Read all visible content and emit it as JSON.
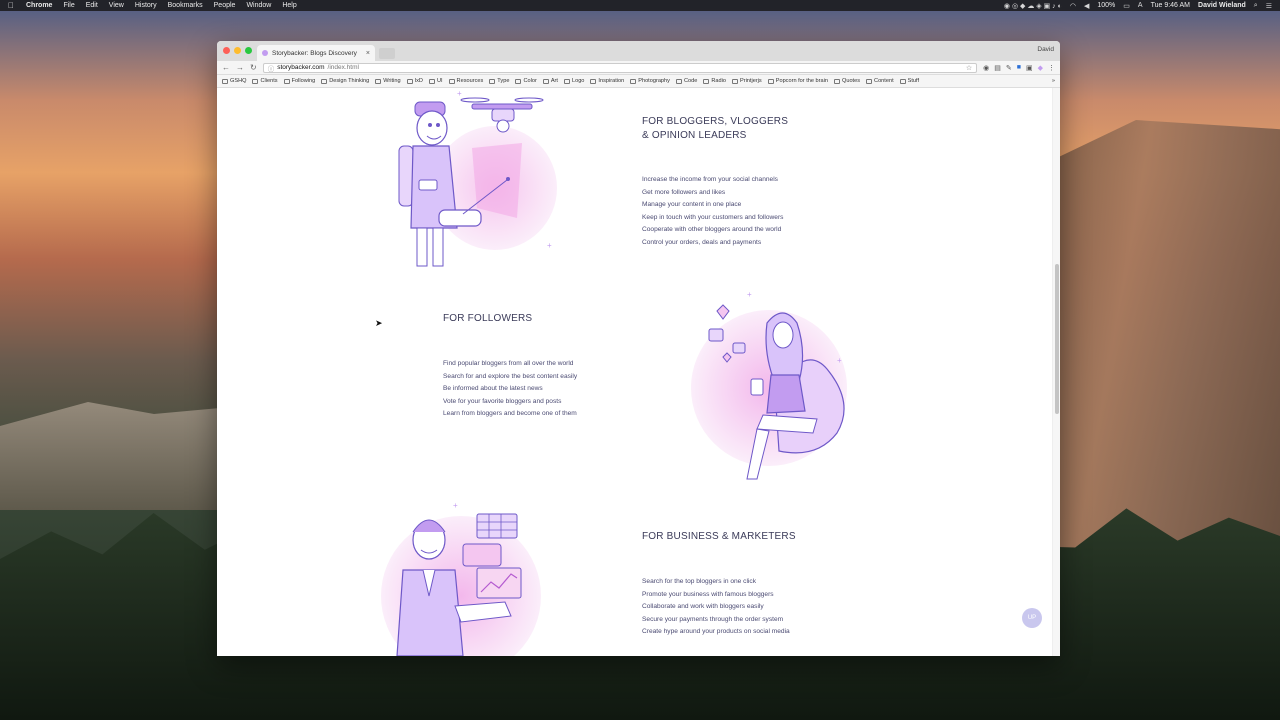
{
  "menubar": {
    "items": [
      "Chrome",
      "File",
      "Edit",
      "View",
      "History",
      "Bookmarks",
      "People",
      "Window",
      "Help"
    ],
    "battery": "100%",
    "clock": "Tue 9:46 AM",
    "user": "David Wieland"
  },
  "browser": {
    "tab_title": "Storybacker: Blogs Discovery",
    "profile": "David",
    "url_host": "storybacker.com",
    "url_path": "/index.html",
    "bookmarks": [
      "GSHQ",
      "Clients",
      "Following",
      "Design Thinking",
      "Writing",
      "IxD",
      "UI",
      "Resources",
      "Type",
      "Color",
      "Art",
      "Logo",
      "Inspiration",
      "Photography",
      "Code",
      "Radio",
      "Printjerjs",
      "Popcorn for the brain",
      "Quotes",
      "Content",
      "Stuff"
    ]
  },
  "sections": [
    {
      "title": "FOR BLOGGERS, VLOGGERS\n& OPINION LEADERS",
      "items": [
        "Increase the income from your social channels",
        "Get more followers and likes",
        "Manage your content in one place",
        "Keep in touch with your customers and followers",
        "Cooperate with other bloggers around the world",
        "Control your orders, deals and payments"
      ]
    },
    {
      "title": "FOR FOLLOWERS",
      "items": [
        "Find popular bloggers from all over the world",
        "Search for and explore the best content easily",
        "Be informed about the latest news",
        "Vote for your favorite bloggers and posts",
        "Learn from bloggers and become one of them"
      ]
    },
    {
      "title": "FOR BUSINESS & MARKETERS",
      "items": [
        "Search for the top bloggers in one click",
        "Promote your business with famous bloggers",
        "Collaborate and work with bloggers easily",
        "Secure your payments through the order system",
        "Create hype around your products on social media"
      ]
    }
  ],
  "up_button": "UP",
  "colors": {
    "accent": "#b58ae6",
    "text": "#3a3a58",
    "list": "#4a4a72"
  }
}
